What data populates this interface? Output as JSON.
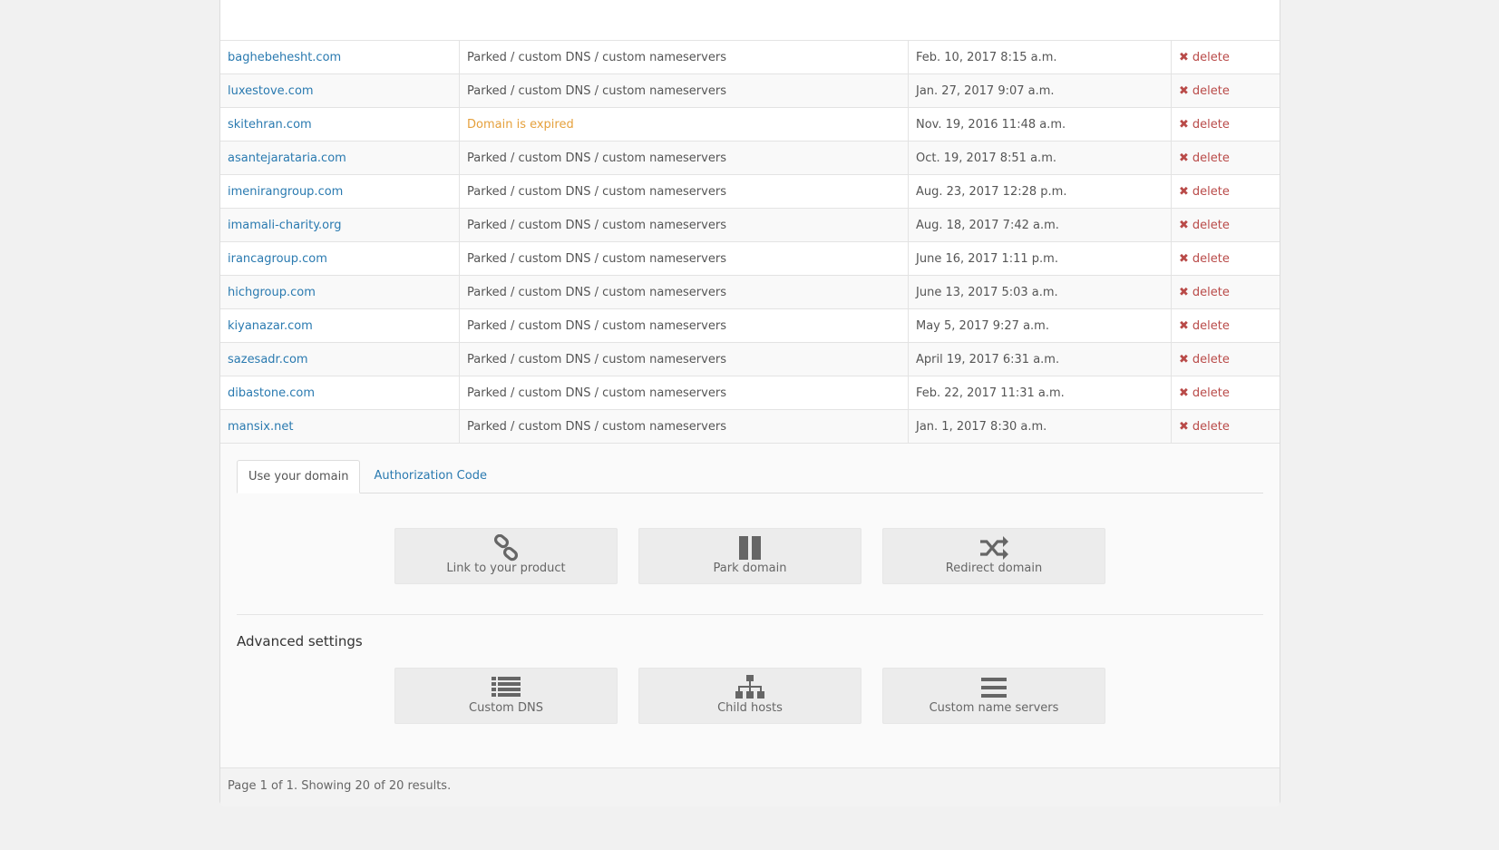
{
  "domains": [
    {
      "name": "baghebehesht.com",
      "status": "Parked / custom DNS / custom nameservers",
      "date": "Feb. 10, 2017 8:15 a.m.",
      "action": "delete",
      "expired": false
    },
    {
      "name": "luxestove.com",
      "status": "Parked / custom DNS / custom nameservers",
      "date": "Jan. 27, 2017 9:07 a.m.",
      "action": "delete",
      "expired": false
    },
    {
      "name": "skitehran.com",
      "status": "Domain is expired",
      "date": "Nov. 19, 2016 11:48 a.m.",
      "action": "delete",
      "expired": true
    },
    {
      "name": "asantejarataria.com",
      "status": "Parked / custom DNS / custom nameservers",
      "date": "Oct. 19, 2017 8:51 a.m.",
      "action": "delete",
      "expired": false
    },
    {
      "name": "imenirangroup.com",
      "status": "Parked / custom DNS / custom nameservers",
      "date": "Aug. 23, 2017 12:28 p.m.",
      "action": "delete",
      "expired": false
    },
    {
      "name": "imamali-charity.org",
      "status": "Parked / custom DNS / custom nameservers",
      "date": "Aug. 18, 2017 7:42 a.m.",
      "action": "delete",
      "expired": false
    },
    {
      "name": "irancagroup.com",
      "status": "Parked / custom DNS / custom nameservers",
      "date": "June 16, 2017 1:11 p.m.",
      "action": "delete",
      "expired": false
    },
    {
      "name": "hichgroup.com",
      "status": "Parked / custom DNS / custom nameservers",
      "date": "June 13, 2017 5:03 a.m.",
      "action": "delete",
      "expired": false
    },
    {
      "name": "kiyanazar.com",
      "status": "Parked / custom DNS / custom nameservers",
      "date": "May 5, 2017 9:27 a.m.",
      "action": "delete",
      "expired": false
    },
    {
      "name": "sazesadr.com",
      "status": "Parked / custom DNS / custom nameservers",
      "date": "April 19, 2017 6:31 a.m.",
      "action": "delete",
      "expired": false
    },
    {
      "name": "dibastone.com",
      "status": "Parked / custom DNS / custom nameservers",
      "date": "Feb. 22, 2017 11:31 a.m.",
      "action": "delete",
      "expired": false
    },
    {
      "name": "mansix.net",
      "status": "Parked / custom DNS / custom nameservers",
      "date": "Jan. 1, 2017 8:30 a.m.",
      "action": "delete",
      "expired": false
    }
  ],
  "tabs": {
    "use_domain": "Use your domain",
    "auth_code": "Authorization Code"
  },
  "actions": {
    "link_product": {
      "label": "Link to your product",
      "icon": "chain-link-icon"
    },
    "park_domain": {
      "label": "Park domain",
      "icon": "pause-icon"
    },
    "redirect_domain": {
      "label": "Redirect domain",
      "icon": "shuffle-icon"
    }
  },
  "advanced": {
    "title": "Advanced settings",
    "custom_dns": {
      "label": "Custom DNS",
      "icon": "list-icon"
    },
    "child_hosts": {
      "label": "Child hosts",
      "icon": "sitemap-icon"
    },
    "custom_ns": {
      "label": "Custom name servers",
      "icon": "menu-bars-icon"
    }
  },
  "pagination": {
    "text": "Page 1 of 1. Showing 20 of 20 results."
  },
  "colors": {
    "link": "#2a7ab0",
    "expired": "#e5a03c",
    "delete": "#b94a48"
  }
}
